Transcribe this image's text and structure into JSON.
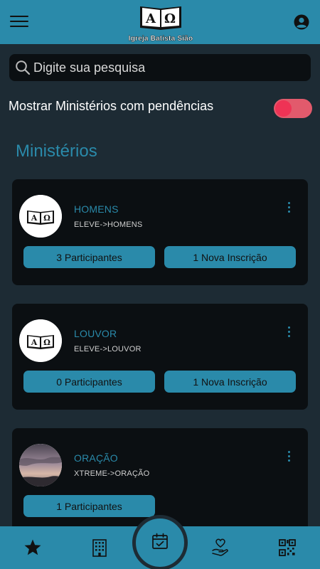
{
  "header": {
    "logo_text": "Igreja Batista Sião",
    "menu_icon": "hamburger-icon",
    "profile_icon": "account-circle-icon"
  },
  "search": {
    "placeholder": "Digite sua pesquisa",
    "value": ""
  },
  "filter": {
    "label": "Mostrar Ministérios com pendências",
    "on": true
  },
  "section_title": "Ministérios",
  "ministries": [
    {
      "name": "HOMENS",
      "path": "ELEVE->HOMENS",
      "avatar": "church-logo",
      "participants": "3 Participantes",
      "new_registrations": "1 Nova Inscrição"
    },
    {
      "name": "LOUVOR",
      "path": "ELEVE->LOUVOR",
      "avatar": "church-logo",
      "participants": "0 Participantes",
      "new_registrations": "1 Nova Inscrição"
    },
    {
      "name": "ORAÇÃO",
      "path": "XTREME->ORAÇÃO",
      "avatar": "sky-photo",
      "participants": "1 Participantes"
    }
  ],
  "bottom_nav": {
    "items": [
      "star-icon",
      "building-icon",
      "calendar-check-icon",
      "hand-heart-icon",
      "qr-code-icon"
    ],
    "active": "calendar-check-icon"
  },
  "colors": {
    "primary": "#2a8aaa",
    "background": "#1d2b34",
    "card": "#0b0f12",
    "toggle": "#e25a6c"
  }
}
